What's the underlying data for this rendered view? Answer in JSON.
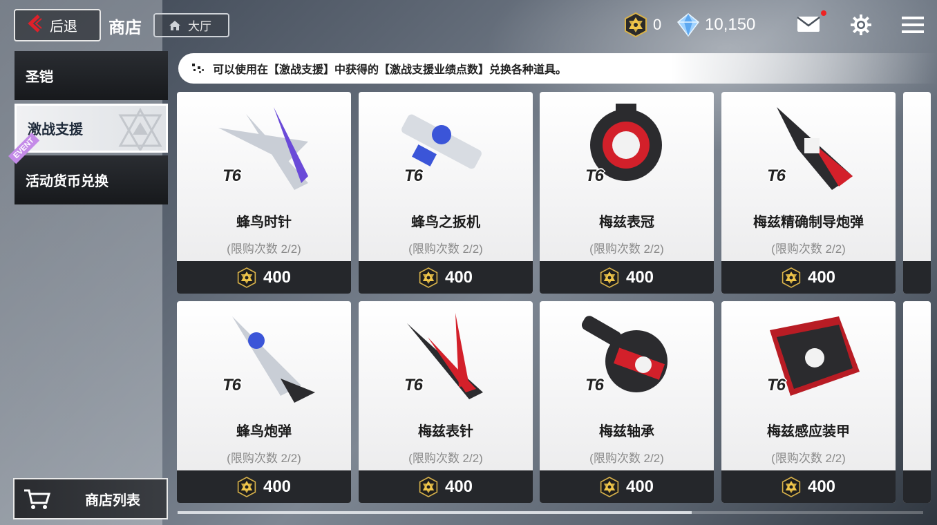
{
  "header": {
    "back_label": "后退",
    "title": "商店",
    "lobby_label": "大厅",
    "currency_medal": "0",
    "currency_crystal": "10,150",
    "icons": [
      "back-arrow-icon",
      "home-icon",
      "medal-icon",
      "crystal-icon",
      "mail-icon",
      "gear-icon",
      "menu-icon"
    ]
  },
  "sidebar": {
    "items": [
      {
        "label": "圣铠",
        "active": false
      },
      {
        "label": "激战支援",
        "active": true
      },
      {
        "label": "活动货币兑换",
        "active": false,
        "tag": "EVENT"
      }
    ],
    "shop_list_label": "商店列表"
  },
  "notice": "可以使用在【激战支援】中获得的【激战支援业绩点数】兑换各种道具。",
  "items": [
    {
      "name": "蜂鸟时针",
      "tier": "T6",
      "limit": "(限购次数 2/2)",
      "price": "400"
    },
    {
      "name": "蜂鸟之扳机",
      "tier": "T6",
      "limit": "(限购次数 2/2)",
      "price": "400"
    },
    {
      "name": "梅兹表冠",
      "tier": "T6",
      "limit": "(限购次数 2/2)",
      "price": "400"
    },
    {
      "name": "梅兹精确制导炮弹",
      "tier": "T6",
      "limit": "(限购次数 2/2)",
      "price": "400"
    },
    {
      "name": "蜂鸟炮弹",
      "tier": "T6",
      "limit": "(限购次数 2/2)",
      "price": "400"
    },
    {
      "name": "梅兹表针",
      "tier": "T6",
      "limit": "(限购次数 2/2)",
      "price": "400"
    },
    {
      "name": "梅兹轴承",
      "tier": "T6",
      "limit": "(限购次数 2/2)",
      "price": "400"
    },
    {
      "name": "梅兹感应装甲",
      "tier": "T6",
      "limit": "(限购次数 2/2)",
      "price": "400"
    }
  ],
  "colors": {
    "accent_red": "#e0202a",
    "price_bar": "#25272b",
    "notify_dot": "#e22222"
  }
}
